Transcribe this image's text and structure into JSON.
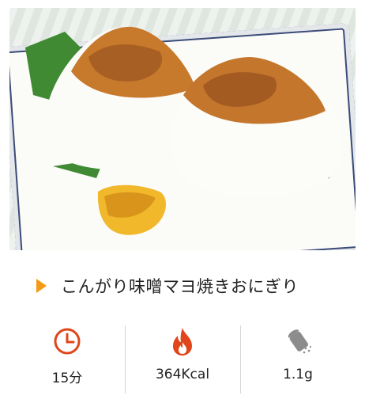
{
  "recipe": {
    "title": "こんがり味噌マヨ焼きおにぎり",
    "stats": {
      "time": "15分",
      "calories": "364Kcal",
      "salt": "1.1g"
    }
  },
  "colors": {
    "accent_orange": "#f39a16",
    "icon_red": "#e0451b",
    "salt_gray": "#8c8c8c",
    "divider": "#d6d6d6"
  },
  "icons": {
    "time": "clock-icon",
    "calories": "flame-icon",
    "salt": "salt-shaker-icon"
  }
}
